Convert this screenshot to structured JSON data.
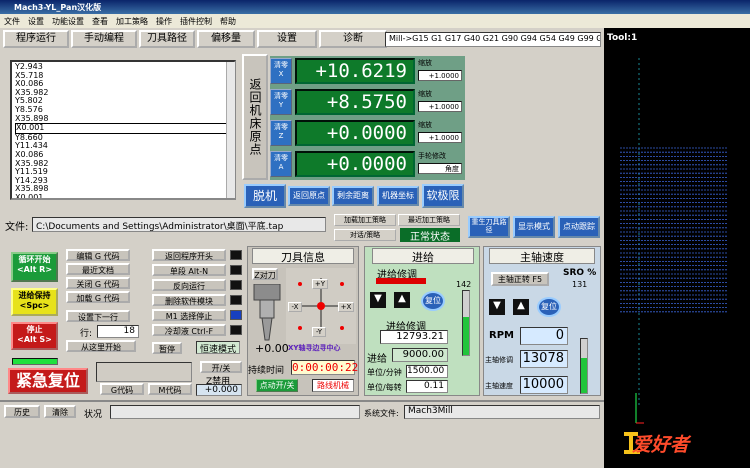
{
  "title": "Mach3-YL_Pan汉化版",
  "menu": [
    "文件",
    "设置",
    "功能设置",
    "查看",
    "加工策略",
    "操作",
    "插件控制",
    "帮助"
  ],
  "tabs": [
    "程序运行",
    "手动编程",
    "刀具路径",
    "偏移量",
    "设置",
    "诊断"
  ],
  "gcodes": "Mill->G15  G1 G17 G40 G21 G90 G94 G54 G49 G99 G64",
  "code_lines": [
    "Y2.943",
    "X5.718",
    "X0.086",
    "X35.982",
    "Y5.802",
    "Y8.576",
    "X35.898",
    "X0.001",
    "Y8.660",
    "Y11.434",
    "X0.086",
    "X35.982",
    "Y11.519",
    "Y14.293",
    "X35.898",
    "X0.001"
  ],
  "code_selected_index": 7,
  "ref_all_label": "返回机床原点",
  "axes": [
    {
      "clear": "清零",
      "letter": "X",
      "value": "+10.6219",
      "scale_label": "缩放",
      "scale": "+1.0000"
    },
    {
      "clear": "清零",
      "letter": "Y",
      "value": "+8.5750",
      "scale_label": "缩放",
      "scale": "+1.0000"
    },
    {
      "clear": "清零",
      "letter": "Z",
      "value": "+0.0000",
      "scale_label": "缩放",
      "scale": "+1.0000"
    },
    {
      "clear": "清零",
      "letter": "A",
      "value": "+0.0000",
      "scale_label": "手轮修改",
      "scale": "角度"
    }
  ],
  "offline_label": "脱机",
  "goto_zero": "返回原点",
  "remain_dist": "剩余距离",
  "machine_coord": "机器坐标",
  "soft_limits": "软极限",
  "file_label": "文件:",
  "file_path": "C:\\Documents and Settings\\Administrator\\桌面\\平底.tap",
  "load_strategy": "加载加工策略",
  "last_strategy": "最近加工策略",
  "dialog_strategy": "对话/策略",
  "status_normal": "正常状态",
  "regen_toolpath": "重生刀具路径",
  "display_mode": "显示模式",
  "jog_follow": "点动跟踪",
  "cycle_start": "循环开始",
  "cycle_start_key": "<Alt R>",
  "feed_hold": "进给保持",
  "feed_hold_key": "<Spc>",
  "stop": "停止",
  "stop_key": "<Alt S>",
  "edit_gcode": "编辑 G 代码",
  "recent_file": "最近文档",
  "close_gcode": "关闭 G 代码",
  "load_gcode": "加载 G 代码",
  "set_next_line": "设置下一行",
  "line_label": "行:",
  "line_value": "18",
  "run_from_here": "从这里开始",
  "rewind": "返回程序开头",
  "single_block": "单段 Alt-N",
  "reverse_run": "反向运行",
  "block_delete": "删除软件模块",
  "m1_optional": "M1 选择停止",
  "flood": "冷却液 Ctrl-F",
  "pause": "暂停",
  "dwell": "恒速模式",
  "emergency": "紧急复位",
  "gcodes_btn": "G代码",
  "mcodes_btn": "M代码",
  "on_off": "开/关",
  "z_inhibit": "Z禁用",
  "z_inhibit_val": "+0.000",
  "tool_info": "刀具信息",
  "z_tool": "Z对刀",
  "tool_z_val": "+0.00",
  "xy_center": "XY轴寻边寻中心",
  "run_time_label": "持续时间",
  "run_time": "0:00:00:22",
  "jog_toggle": "点动开/关",
  "dry_run": "路线机械",
  "feed_header": "进给",
  "feed_adjust": "进给修调",
  "feed_pct": "142",
  "reset": "复位",
  "feed_adjust2": "进给修调",
  "feed_display": "12793.21",
  "feed_label": "进给",
  "feed_value": "9000.00",
  "unit_min": "单位/分钟",
  "unit_min_val": "1500.00",
  "unit_rev": "单位/每转",
  "unit_rev_val": "0.11",
  "spindle_header": "主轴速度",
  "spindle_cw": "主轴正转 F5",
  "sro_label": "SRO %",
  "sro_value": "131",
  "rpm_label": "RPM",
  "rpm_value": "0",
  "spindle_adjust": "主轴修调",
  "spindle_adjust_val": "13078",
  "spindle_speed": "主轴速度",
  "spindle_speed_val": "10000",
  "history": "历史",
  "clear": "清除",
  "status_label": "状况",
  "profile_label": "系统文件:",
  "profile": "Mach3Mill",
  "toolpath_label": "Tool:1",
  "watermark": "爱好者",
  "colors": {
    "dro_green": "#0e7a2a",
    "blue": "#2a61b8",
    "red": "#c41a1a",
    "green": "#1b9b3a",
    "toolpath": "#3a64d8"
  }
}
